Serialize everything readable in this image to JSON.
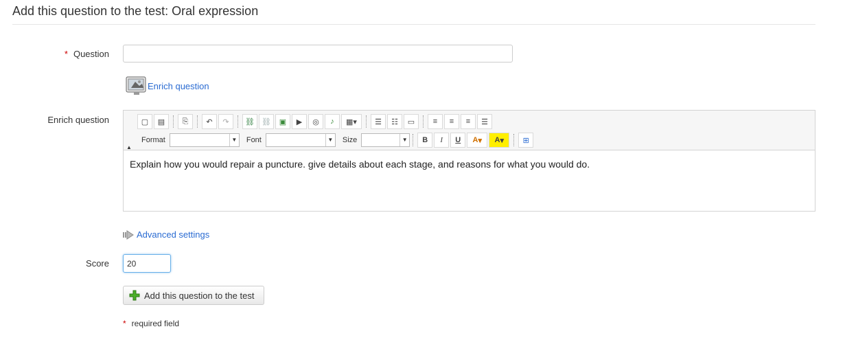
{
  "page": {
    "title": "Add this question to the test: Oral expression"
  },
  "form": {
    "question_label": "Question",
    "question_value": "",
    "enrich_link": "Enrich question",
    "enrich_label": "Enrich question",
    "editor": {
      "format_label": "Format",
      "font_label": "Font",
      "size_label": "Size",
      "content": "Explain how you would repair a puncture. give details about each stage, and reasons for what you would do.",
      "buttons": {
        "bold": "B",
        "italic": "I",
        "underline": "U",
        "text_color": "A",
        "bg_color": "A"
      }
    },
    "advanced_link": "Advanced settings",
    "score_label": "Score",
    "score_value": "20",
    "submit_label": "Add this question to the test",
    "required_star": "*",
    "required_note": "required field"
  },
  "colors": {
    "link": "#2a6bd2",
    "required": "#cc0000",
    "focus": "#66afe9",
    "plus": "#4caf2a"
  }
}
